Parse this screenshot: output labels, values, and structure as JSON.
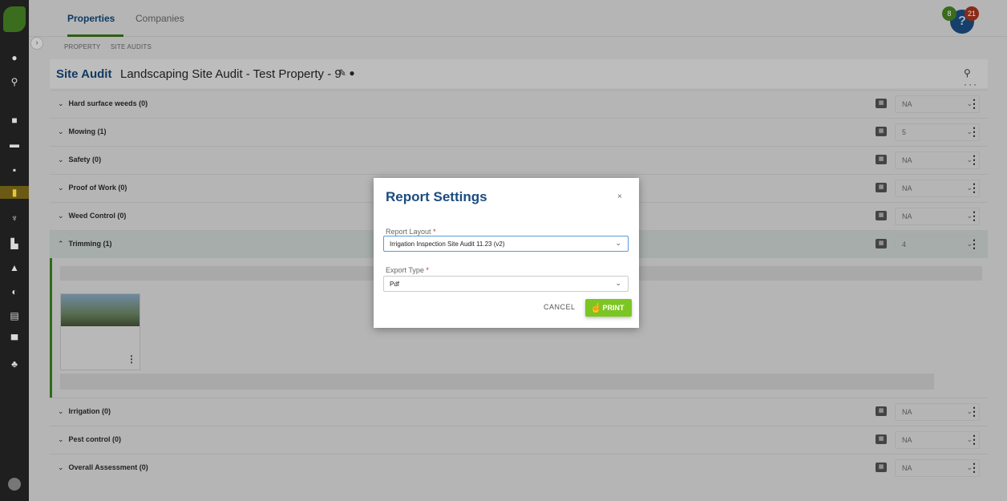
{
  "nav": {
    "tabs": [
      {
        "label": "Properties",
        "active": true
      },
      {
        "label": "Companies",
        "active": false
      }
    ],
    "breadcrumbs": [
      "PROPERTY",
      "SITE AUDITS"
    ],
    "help_glyph": "?",
    "badges": {
      "green": "8",
      "red": "21"
    }
  },
  "rail": {
    "icons": [
      "plus-circle-icon",
      "search-icon",
      "checkbox-icon",
      "calendar-icon",
      "card-icon",
      "building-icon",
      "trophy-icon",
      "clipboard-icon",
      "briefcase-icon",
      "pie-icon",
      "report-icon",
      "trash-icon",
      "people-icon"
    ]
  },
  "header": {
    "title": "Site Audit",
    "subtitle": "Landscaping Site Audit - Test Property - 9"
  },
  "sections": [
    {
      "label": "Hard surface weeds (0)",
      "score": "NA"
    },
    {
      "label": "Mowing (1)",
      "score": "5"
    },
    {
      "label": "Safety (0)",
      "score": "NA"
    },
    {
      "label": "Proof of Work (0)",
      "score": "NA"
    },
    {
      "label": "Weed Control (0)",
      "score": "NA"
    },
    {
      "label": "Trimming (1)",
      "score": "4"
    },
    {
      "label": "Irrigation (0)",
      "score": "NA"
    },
    {
      "label": "Pest control (0)",
      "score": "NA"
    },
    {
      "label": "Overall Assessment (0)",
      "score": "NA"
    }
  ],
  "modal": {
    "title": "Report Settings",
    "close": "×",
    "layout_label": "Report Layout",
    "layout_value": "Irrigation Inspection Site Audit 11.23 (v2)",
    "export_label": "Export Type",
    "export_value": "Pdf",
    "required": "*",
    "cancel": "CANCEL",
    "print": "PRINT"
  },
  "colors": {
    "accent": "#7bc623",
    "title_blue": "#1a4c7f",
    "brand_green": "#3a6e1e"
  }
}
